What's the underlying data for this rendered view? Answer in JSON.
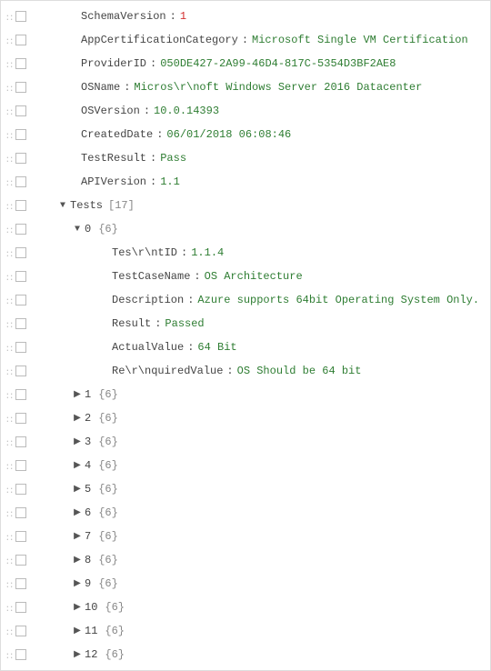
{
  "root": [
    {
      "key": "SchemaVersion",
      "value": "1",
      "type": "num"
    },
    {
      "key": "AppCertificationCategory",
      "value": "Microsoft Single VM Certification",
      "type": "str"
    },
    {
      "key": "ProviderID",
      "value": "050DE427-2A99-46D4-817C-5354D3BF2AE8",
      "type": "str"
    },
    {
      "key": "OSName",
      "value": "Micros\\r\\noft Windows Server 2016 Datacenter",
      "type": "str"
    },
    {
      "key": "OSVersion",
      "value": "10.0.14393",
      "type": "str"
    },
    {
      "key": "CreatedDate",
      "value": "06/01/2018 06:08:46",
      "type": "str"
    },
    {
      "key": "TestResult",
      "value": "Pass",
      "type": "str"
    },
    {
      "key": "APIVersion",
      "value": "1.1",
      "type": "str"
    }
  ],
  "tests_label": "Tests",
  "tests_count": "[17]",
  "test0_index": "0",
  "test0_count": "{6}",
  "test0_fields": [
    {
      "key": "Tes\\r\\ntID",
      "value": "1.1.4",
      "type": "str"
    },
    {
      "key": "TestCaseName",
      "value": "OS Architecture",
      "type": "str"
    },
    {
      "key": "Description",
      "value": "Azure supports 64bit Operating System Only.",
      "type": "str"
    },
    {
      "key": "Result",
      "value": "Passed",
      "type": "str"
    },
    {
      "key": "ActualValue",
      "value": "64 Bit",
      "type": "str"
    },
    {
      "key": "Re\\r\\nquiredValue",
      "value": "OS Should be 64 bit",
      "type": "str"
    }
  ],
  "collapsed": [
    {
      "index": "1",
      "count": "{6}"
    },
    {
      "index": "2",
      "count": "{6}"
    },
    {
      "index": "3",
      "count": "{6}"
    },
    {
      "index": "4",
      "count": "{6}"
    },
    {
      "index": "5",
      "count": "{6}"
    },
    {
      "index": "6",
      "count": "{6}"
    },
    {
      "index": "7",
      "count": "{6}"
    },
    {
      "index": "8",
      "count": "{6}"
    },
    {
      "index": "9",
      "count": "{6}"
    },
    {
      "index": "10",
      "count": "{6}"
    },
    {
      "index": "11",
      "count": "{6}"
    },
    {
      "index": "12",
      "count": "{6}"
    }
  ]
}
